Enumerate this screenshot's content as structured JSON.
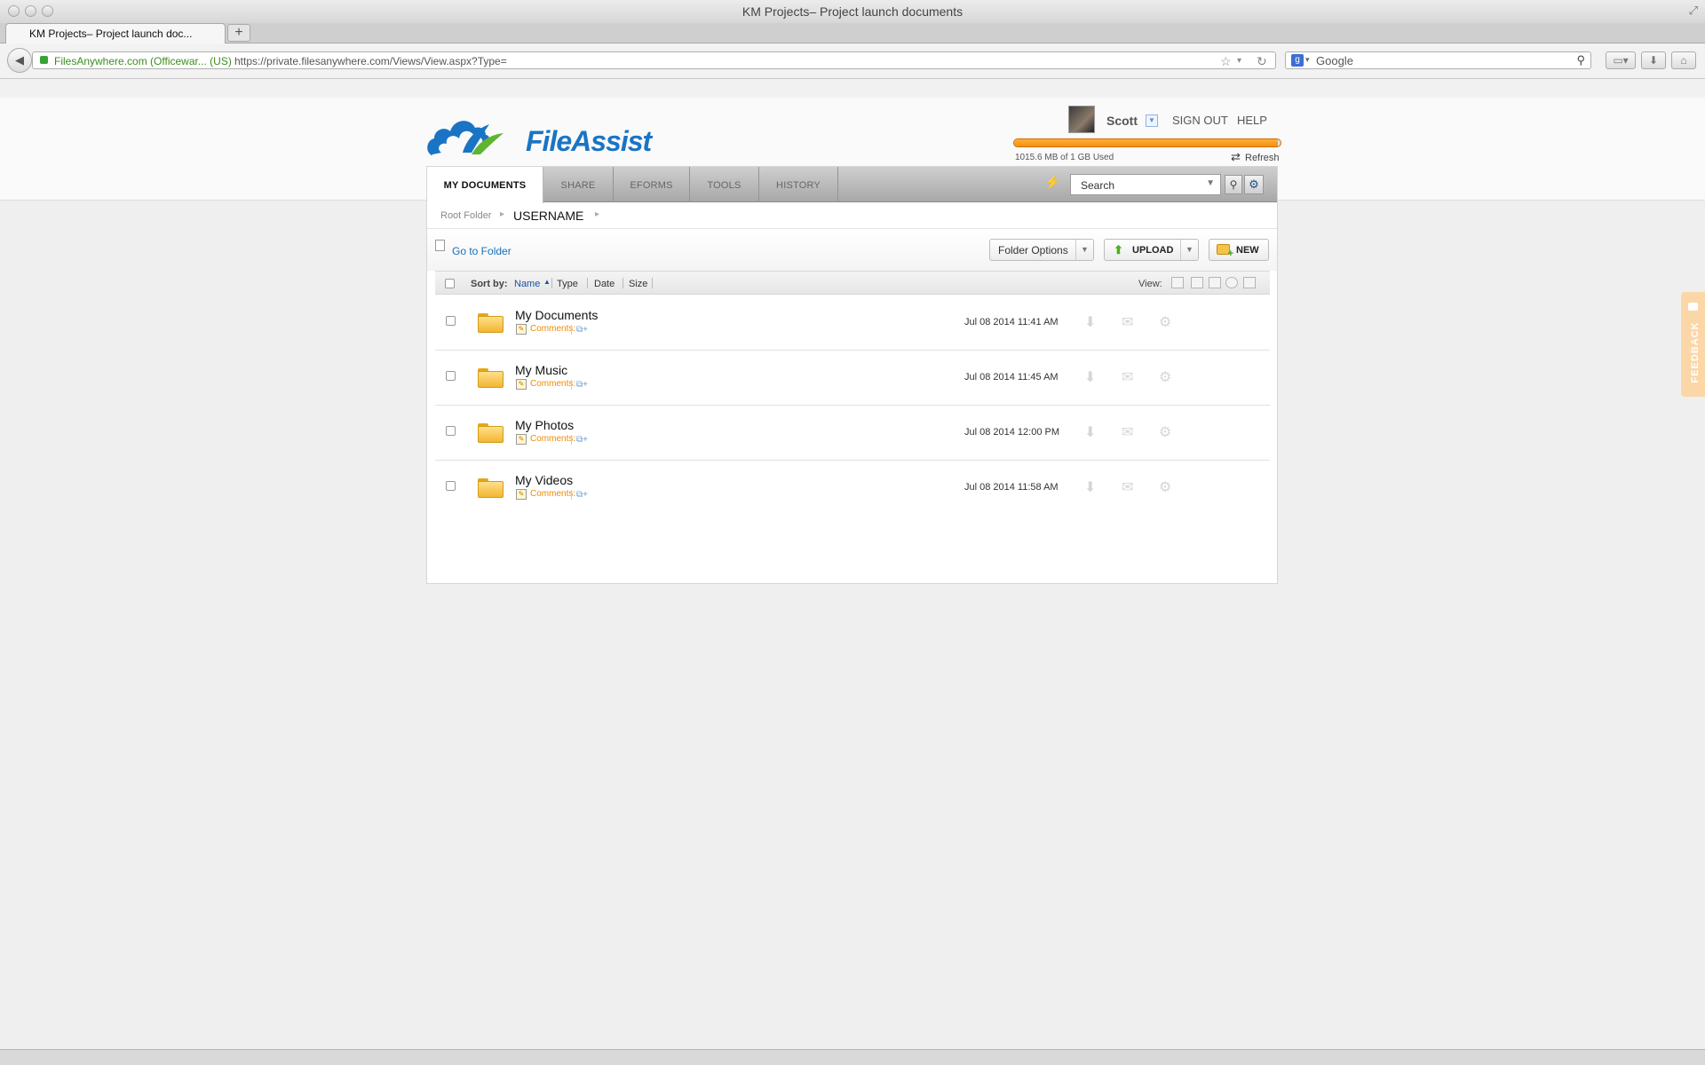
{
  "browser": {
    "window_title": "KM Projects– Project launch documents",
    "tab_title": "KM Projects– Project launch doc...",
    "new_tab_symbol": "+",
    "site_identity": "FilesAnywhere.com (Officewar...  (US)",
    "url": "https://private.filesanywhere.com/Views/View.aspx?Type=",
    "search_engine_placeholder": "Google",
    "icons": [
      "back-icon",
      "lock-icon",
      "bookmark-star-icon",
      "refresh-icon",
      "google-icon",
      "search-icon",
      "screenshot-icon",
      "downloads-icon",
      "home-icon",
      "resize-icon"
    ]
  },
  "app": {
    "logo_text": "FileAssist",
    "brand_colors": {
      "primary": "#1a74c4",
      "accent": "#5fb52f",
      "quota": "#f7900d"
    }
  },
  "user": {
    "name": "Scott",
    "sign_out_label": "SIGN OUT",
    "help_label": "HELP",
    "quota_text": "1015.6 MB of 1 GB Used",
    "quota_fraction": 0.99,
    "refresh_label": "Refresh"
  },
  "nav": {
    "tabs": [
      "MY DOCUMENTS",
      "SHARE",
      "EFORMS",
      "TOOLS",
      "HISTORY"
    ],
    "active_tab": "MY DOCUMENTS",
    "search_placeholder": "Search"
  },
  "breadcrumb": {
    "root": "Root Folder",
    "current": "USERNAME"
  },
  "toolbar": {
    "go_to_folder": "Go to Folder",
    "folder_options": "Folder Options",
    "upload": "UPLOAD",
    "new": "NEW"
  },
  "sort": {
    "label": "Sort by:",
    "columns": [
      "Name",
      "Type",
      "Date",
      "Size"
    ],
    "active": "Name",
    "direction": "ascending",
    "view_label": "View:"
  },
  "files": [
    {
      "name": "My Documents",
      "comments": "Comments:",
      "date": "Jul 08 2014 11:41 AM"
    },
    {
      "name": "My Music",
      "comments": "Comments:",
      "date": "Jul 08 2014 11:45 AM"
    },
    {
      "name": "My Photos",
      "comments": "Comments:",
      "date": "Jul 08 2014 12:00 PM"
    },
    {
      "name": "My Videos",
      "comments": "Comments:",
      "date": "Jul 08 2014 11:58 AM"
    }
  ],
  "feedback": {
    "label": "FEEDBACK"
  }
}
